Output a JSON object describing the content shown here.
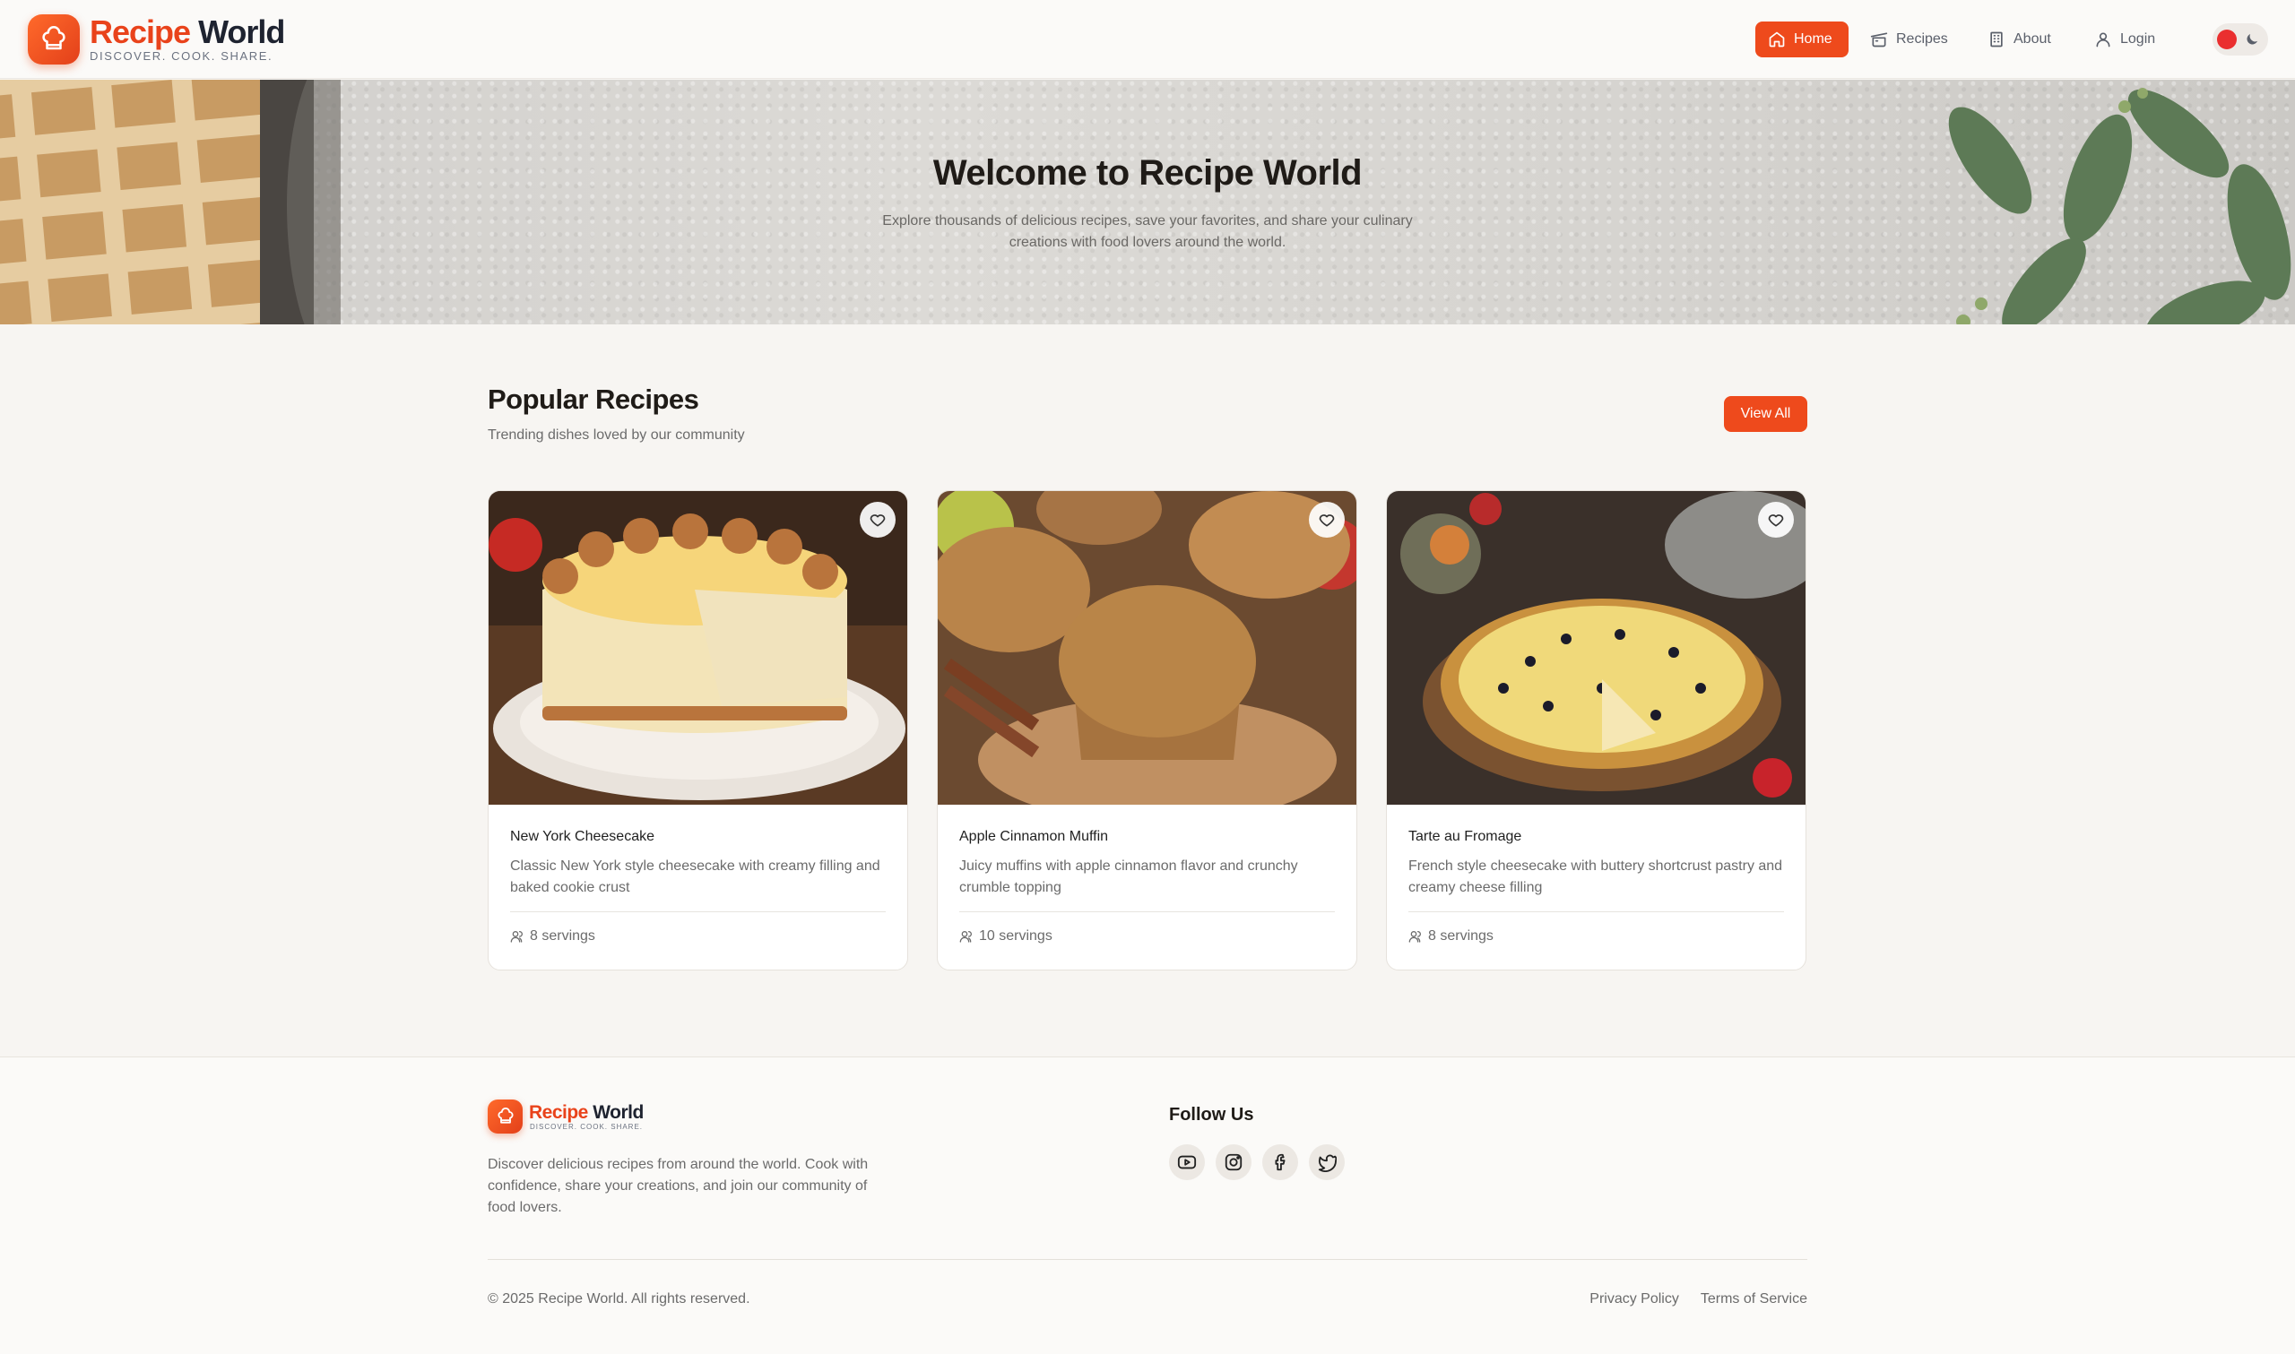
{
  "header": {
    "logo_title_part1": "Recipe",
    "logo_title_part2": "World",
    "tagline": "DISCOVER. COOK. SHARE.",
    "nav": [
      {
        "label": "Home",
        "icon": "home-icon",
        "active": true
      },
      {
        "label": "Recipes",
        "icon": "pot-icon"
      },
      {
        "label": "About",
        "icon": "building-icon"
      },
      {
        "label": "Login",
        "icon": "user-icon"
      }
    ],
    "theme_toggle_icons": [
      "sun-icon",
      "moon-icon"
    ]
  },
  "hero": {
    "title": "Welcome to Recipe World",
    "subtitle": "Explore thousands of delicious recipes, save your favorites, and share your culinary creations with food lovers around the world."
  },
  "popular": {
    "title": "Popular Recipes",
    "subtitle": "Trending dishes loved by our community",
    "view_all_label": "View All",
    "recipes": [
      {
        "title": "New York Cheesecake",
        "description": "Classic New York style cheesecake with creamy filling and baked cookie crust",
        "servings": "8 servings"
      },
      {
        "title": "Apple Cinnamon Muffin",
        "description": "Juicy muffins with apple cinnamon flavor and crunchy crumble topping",
        "servings": "10 servings"
      },
      {
        "title": "Tarte au Fromage",
        "description": "French style cheesecake with buttery shortcrust pastry and creamy cheese filling",
        "servings": "8 servings"
      }
    ]
  },
  "footer": {
    "logo_title_part1": "Recipe",
    "logo_title_part2": "World",
    "tagline": "DISCOVER. COOK. SHARE.",
    "description": "Discover delicious recipes from around the world. Cook with confidence, share your creations, and join our community of food lovers.",
    "follow_title": "Follow Us",
    "socials": [
      "youtube-icon",
      "instagram-icon",
      "facebook-icon",
      "twitter-icon"
    ],
    "copyright": "© 2025 Recipe World. All rights reserved.",
    "links": [
      "Privacy Policy",
      "Terms of Service"
    ]
  },
  "colors": {
    "accent": "#ee4a1c",
    "background": "#f7f5f2",
    "header_bg": "#fbfaf8"
  }
}
